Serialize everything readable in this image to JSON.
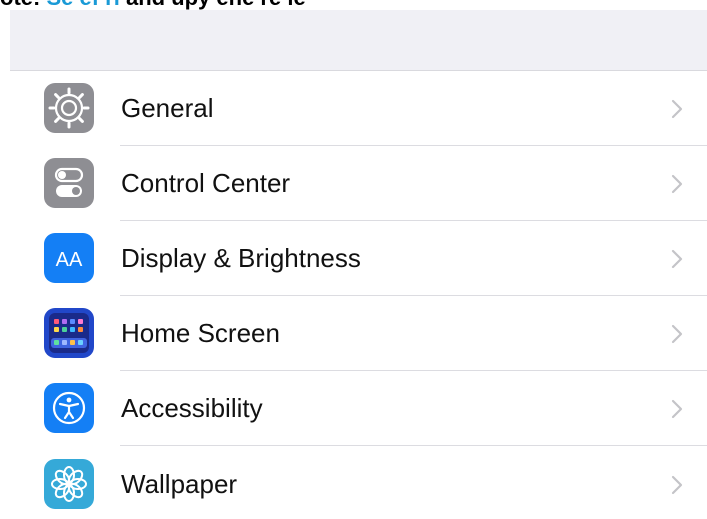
{
  "header_caption": {
    "prefix": "ote:",
    "link": "Se ef rl",
    "suffix": "and upy ehe re le"
  },
  "rows": [
    {
      "label": "General",
      "icon": "gear-icon",
      "icon_color": "#8e8e93"
    },
    {
      "label": "Control Center",
      "icon": "toggle-switches-icon",
      "icon_color": "#8e8e93"
    },
    {
      "label": "Display & Brightness",
      "icon": "text-size-icon",
      "icon_color": "#147ff5"
    },
    {
      "label": "Home Screen",
      "icon": "app-grid-icon",
      "icon_color": "#2147c9"
    },
    {
      "label": "Accessibility",
      "icon": "accessibility-icon",
      "icon_color": "#147ff5"
    },
    {
      "label": "Wallpaper",
      "icon": "flower-icon",
      "icon_color": "#35a9d8"
    }
  ]
}
